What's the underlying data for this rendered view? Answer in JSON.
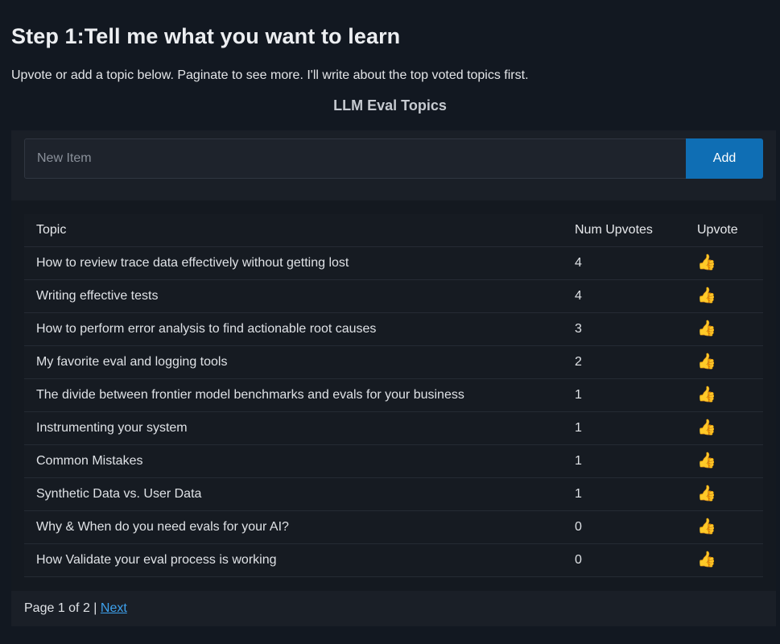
{
  "page": {
    "title": "Step 1:Tell me what you want to learn",
    "subtitle": "Upvote or add a topic below. Paginate to see more. I'll write about the top voted topics first.",
    "section_title": "LLM Eval Topics"
  },
  "add_form": {
    "placeholder": "New Item",
    "value": "",
    "add_label": "Add",
    "accent_color": "#0f6eb4"
  },
  "table": {
    "headers": {
      "topic": "Topic",
      "votes": "Num Upvotes",
      "upvote": "Upvote"
    },
    "upvote_icon": "👍",
    "upvote_icon_name": "thumbs-up-icon",
    "rows": [
      {
        "topic": "How to review trace data effectively without getting lost",
        "votes": "4"
      },
      {
        "topic": "Writing effective tests",
        "votes": "4"
      },
      {
        "topic": "How to perform error analysis to find actionable root causes",
        "votes": "3"
      },
      {
        "topic": "My favorite eval and logging tools",
        "votes": "2"
      },
      {
        "topic": "The divide between frontier model benchmarks and evals for your business",
        "votes": "1"
      },
      {
        "topic": "Instrumenting your system",
        "votes": "1"
      },
      {
        "topic": "Common Mistakes",
        "votes": "1"
      },
      {
        "topic": "Synthetic Data vs. User Data",
        "votes": "1"
      },
      {
        "topic": "Why & When do you need evals for your AI?",
        "votes": "0"
      },
      {
        "topic": "How Validate your eval process is working",
        "votes": "0"
      }
    ]
  },
  "pagination": {
    "status": "Page 1 of 2",
    "separator": "|",
    "next_label": "Next"
  }
}
